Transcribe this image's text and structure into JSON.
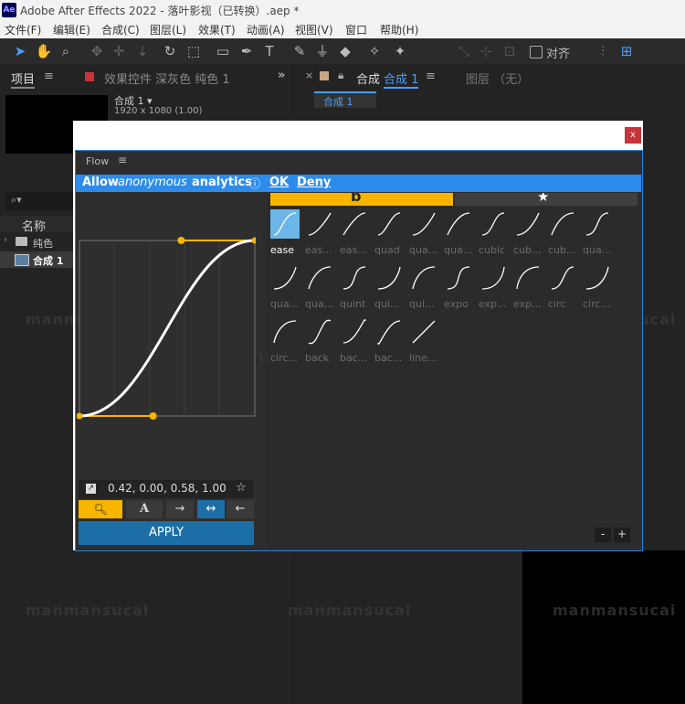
{
  "app": {
    "icon": "Ae",
    "title": "Adobe After Effects 2022 - 落叶影视（已转换）.aep *"
  },
  "menu": [
    "文件(F)",
    "编辑(E)",
    "合成(C)",
    "图层(L)",
    "效果(T)",
    "动画(A)",
    "视图(V)",
    "窗口",
    "帮助(H)"
  ],
  "toolbar": {
    "snap_label": "对齐"
  },
  "project_panel": {
    "tab": "项目",
    "effects_tab": "效果控件 深灰色 纯色 1",
    "comp_name": "合成 1 ▾",
    "comp_info": "1920 x 1080 (1.00)",
    "column_name": "名称",
    "items": [
      {
        "name": "纯色",
        "type": "folder"
      },
      {
        "name": "合成 1",
        "type": "comp"
      }
    ]
  },
  "comp_panel": {
    "tab_label": "合成",
    "tab_name": "合成 1",
    "layer_tab": "图层 （无）",
    "sub_tab": "合成 1"
  },
  "flow": {
    "title": "Flow",
    "close": "x",
    "analytics": {
      "prefix": "Allow",
      "emphasis": "anonymous",
      "suffix": "analytics",
      "ok": "OK",
      "deny": "Deny"
    },
    "bezier": {
      "x1": 0.42,
      "y1": 0.0,
      "x2": 0.58,
      "y2": 1.0
    },
    "values_text": "0.42, 0.00, 0.58, 1.00",
    "apply": "APPLY",
    "zoom_minus": "-",
    "zoom_plus": "+",
    "presets": [
      {
        "label": "ease",
        "selected": true
      },
      {
        "label": "eas..."
      },
      {
        "label": "eas..."
      },
      {
        "label": "quad"
      },
      {
        "label": "qua..."
      },
      {
        "label": "qua..."
      },
      {
        "label": "cubic"
      },
      {
        "label": "cub..."
      },
      {
        "label": "cub..."
      },
      {
        "label": "qua..."
      },
      {
        "label": "qua..."
      },
      {
        "label": "qua..."
      },
      {
        "label": "quint"
      },
      {
        "label": "qui..."
      },
      {
        "label": "qui..."
      },
      {
        "label": "expo"
      },
      {
        "label": "exp..."
      },
      {
        "label": "exp..."
      },
      {
        "label": "circ"
      },
      {
        "label": "circ..."
      },
      {
        "label": "circ..."
      },
      {
        "label": "back"
      },
      {
        "label": "bac..."
      },
      {
        "label": "bac..."
      },
      {
        "label": "line..."
      }
    ]
  },
  "watermark": "manmansucai",
  "colors": {
    "accent_yellow": "#f7b500",
    "accent_blue": "#2d8ceb",
    "apply_blue": "#1c6fa6",
    "selected_thumb": "#6cb6e8"
  }
}
